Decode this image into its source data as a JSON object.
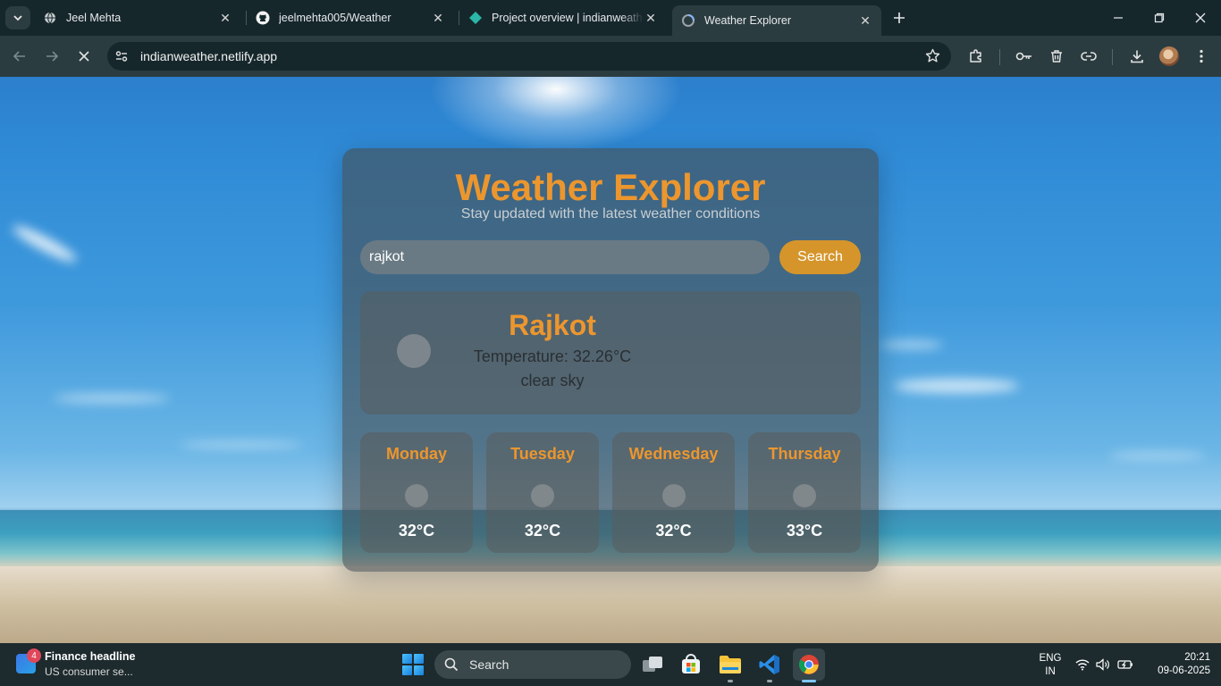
{
  "browser": {
    "tabs": [
      {
        "label": "Jeel Mehta",
        "icon": "globe-icon"
      },
      {
        "label": "jeelmehta005/Weather",
        "icon": "github-icon"
      },
      {
        "label": "Project overview | indianweathe",
        "icon": "netlify-icon"
      },
      {
        "label": "Weather Explorer",
        "icon": "loading-icon",
        "active": true
      }
    ],
    "url": "indianweather.netlify.app"
  },
  "app": {
    "title": "Weather Explorer",
    "subtitle": "Stay updated with the latest weather conditions",
    "search": {
      "value": "rajkot",
      "button_label": "Search"
    },
    "current": {
      "city": "Rajkot",
      "temperature": "Temperature: 32.26°C",
      "description": "clear sky"
    },
    "forecast": [
      {
        "day": "Monday",
        "temp": "32°C"
      },
      {
        "day": "Tuesday",
        "temp": "32°C"
      },
      {
        "day": "Wednesday",
        "temp": "32°C"
      },
      {
        "day": "Thursday",
        "temp": "33°C"
      }
    ],
    "colors": {
      "accent": "#ec962e",
      "button": "#d5952b"
    }
  },
  "taskbar": {
    "widget": {
      "badge": "4",
      "title": "Finance headline",
      "text": "US consumer se..."
    },
    "search_label": "Search",
    "lang_line1": "ENG",
    "lang_line2": "IN",
    "time": "20:21",
    "date": "09-06-2025"
  }
}
